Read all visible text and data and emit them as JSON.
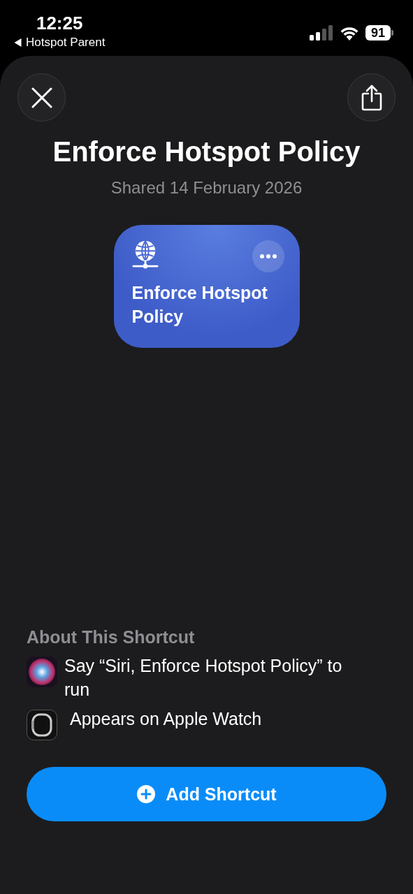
{
  "status_bar": {
    "time": "12:25",
    "back_label": "Hotspot Parent",
    "battery": "91"
  },
  "sheet": {
    "title": "Enforce Hotspot Policy",
    "subtitle": "Shared 14 February 2026"
  },
  "shortcut_card": {
    "name": "Enforce Hotspot Policy"
  },
  "about": {
    "heading": "About This Shortcut",
    "items": [
      {
        "kind": "siri",
        "text": "Say “Siri, Enforce Hotspot Policy” to run"
      },
      {
        "kind": "watch",
        "text": "Appears on Apple Watch"
      }
    ]
  },
  "primary_button": {
    "label": "Add Shortcut"
  }
}
